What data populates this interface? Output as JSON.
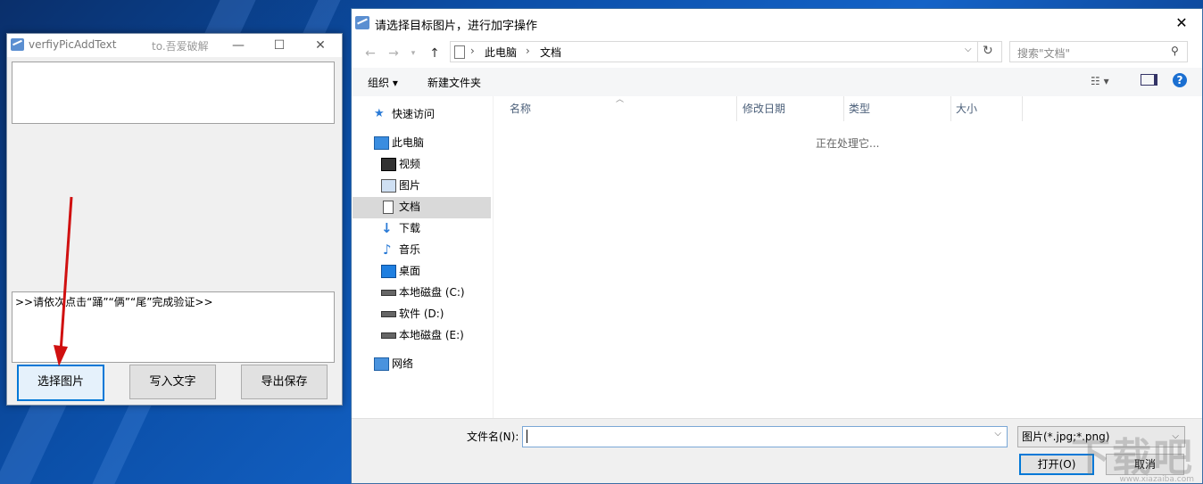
{
  "app": {
    "title": "verfiyPicAddText",
    "subtitle": "to.吾爱破解",
    "captcha_text": ">>请依次点击“踊”“俩”“尾”完成验证>>",
    "buttons": {
      "select": "选择图片",
      "write": "写入文字",
      "export": "导出保存"
    },
    "caption": {
      "minimize": "—",
      "maximize": "☐",
      "close": "✕"
    }
  },
  "dialog": {
    "title": "请选择目标图片，进行加字操作",
    "close": "✕",
    "breadcrumb": [
      "此电脑",
      "文档"
    ],
    "search_placeholder": "搜索\"文档\"",
    "toolbar": {
      "organize": "组织 ▾",
      "new_folder": "新建文件夹"
    },
    "nav": {
      "quick_access": "快速访问",
      "this_pc": "此电脑",
      "items": [
        "视频",
        "图片",
        "文档",
        "下载",
        "音乐",
        "桌面",
        "本地磁盘 (C:)",
        "软件 (D:)",
        "本地磁盘 (E:)"
      ],
      "network": "网络"
    },
    "columns": {
      "name": "名称",
      "date": "修改日期",
      "type": "类型",
      "size": "大小"
    },
    "status": "正在处理它...",
    "filename_label": "文件名(N):",
    "filename_value": "",
    "filter": "图片(*.jpg;*.png)",
    "open": "打开(O)",
    "cancel": "取消"
  },
  "watermark": {
    "text": "下载吧",
    "sub": "www.xiazaiba.com"
  },
  "annotation_color": "#d01010"
}
